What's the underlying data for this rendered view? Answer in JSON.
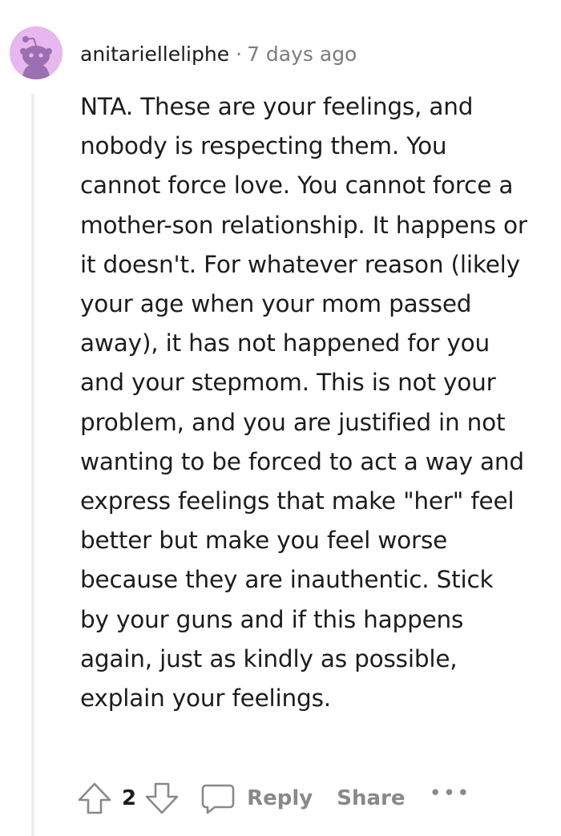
{
  "comment": {
    "username": "anitarielleliphe",
    "separator": "·",
    "timestamp": "7 days ago",
    "avatar_icon": "snoo-avatar-icon",
    "avatar_color": "#e7b7f0",
    "body": "NTA. These are your feelings, and nobody is respecting them. You cannot force love. You cannot force a mother-son relationship. It happens or it doesn't. For whatever reason (likely your age when your mom passed away), it has not happened for you and your stepmom. This is not your problem, and you are justified in not wanting to be forced to act a way and express feelings that make \"her\" feel better but make you feel worse because they are inauthentic. Stick by your guns and if this happens again, just as kindly as possible, explain your feelings."
  },
  "actions": {
    "upvote_icon": "upvote-arrow-icon",
    "score": "2",
    "downvote_icon": "downvote-arrow-icon",
    "reply_icon": "speech-bubble-icon",
    "reply_label": "Reply",
    "share_label": "Share",
    "more_label": "•••"
  },
  "colors": {
    "text": "#1c1c1c",
    "meta": "#7c7c7c",
    "action": "#878a8c",
    "thread_line": "#edeff1"
  }
}
